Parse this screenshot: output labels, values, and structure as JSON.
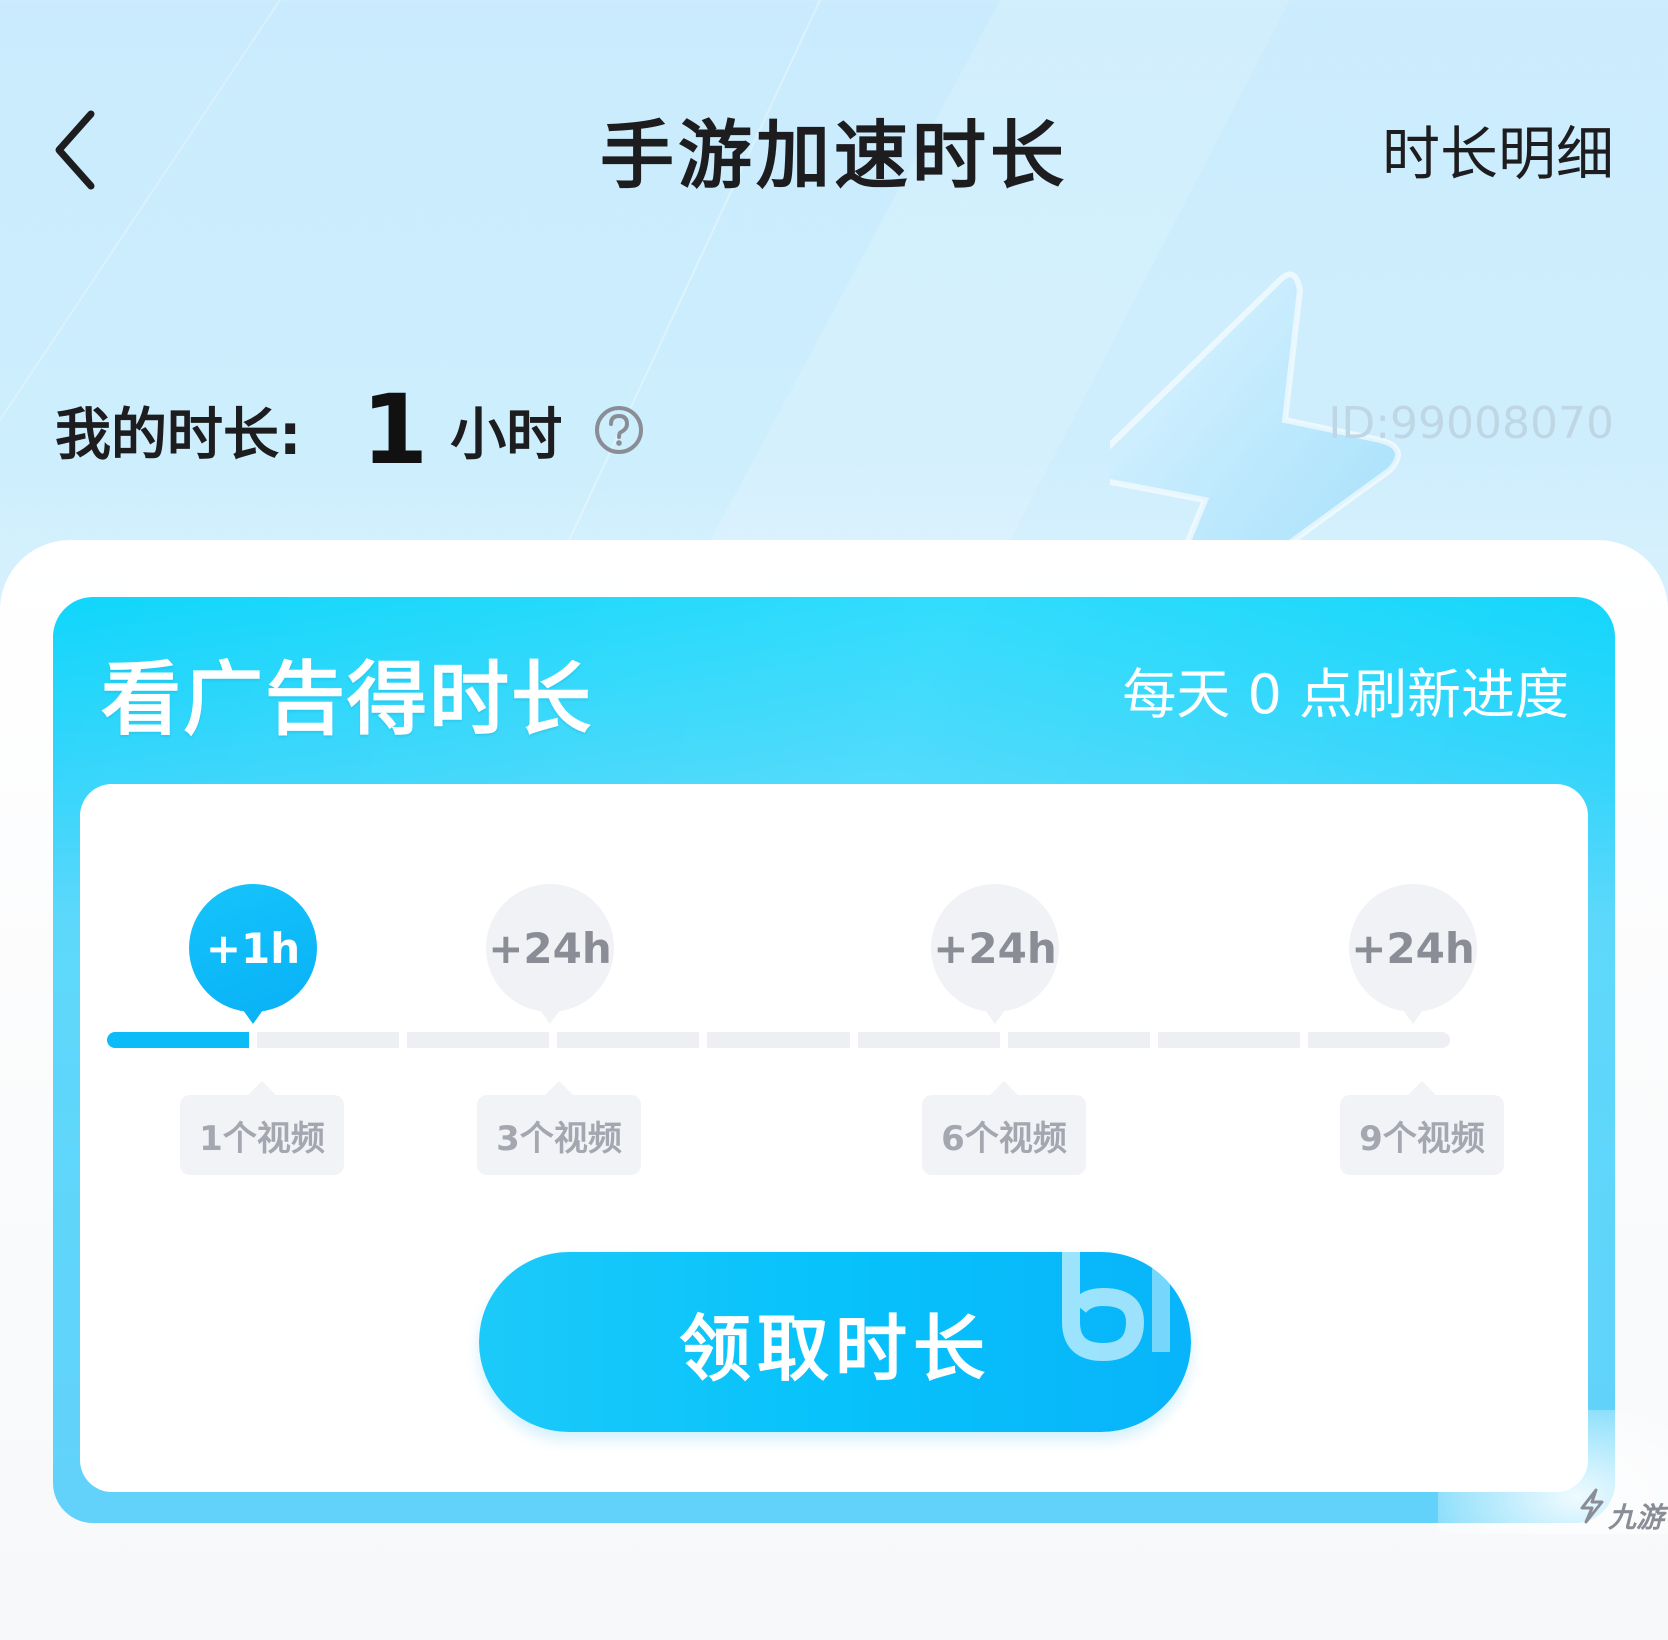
{
  "header": {
    "title": "手游加速时长",
    "detail_link": "时长明细"
  },
  "balance": {
    "label": "我的时长:",
    "value": "1",
    "unit": "小时",
    "user_id": "ID:99008070"
  },
  "ad_card": {
    "title": "看广告得时长",
    "refresh_hint": "每天 0 点刷新进度",
    "milestones": [
      {
        "reward": "+1h",
        "videos": "1个视频",
        "reached": true
      },
      {
        "reward": "+24h",
        "videos": "3个视频",
        "reached": false
      },
      {
        "reward": "+24h",
        "videos": "6个视频",
        "reached": false
      },
      {
        "reward": "+24h",
        "videos": "9个视频",
        "reached": false
      }
    ],
    "progress_segments_filled": 1,
    "progress_segments_total": 9,
    "claim_button": "领取时长"
  },
  "watermark": {
    "text": "九游"
  },
  "colors": {
    "accent": "#0bbcf8",
    "card_top": "#10d6fb",
    "title_text": "#1d1d1f",
    "inactive_gray": "#8a8d96"
  }
}
